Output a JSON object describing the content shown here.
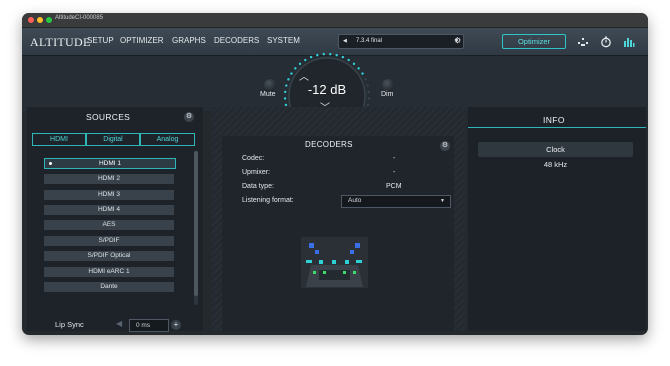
{
  "window": {
    "title": "AltitudeCI-000085"
  },
  "nav": {
    "logo": "ALTITUDE",
    "items": [
      "SETUP",
      "OPTIMIZER",
      "GRAPHS",
      "DECODERS",
      "SYSTEM"
    ],
    "preset": "7.3.4 final",
    "optimizer_label": "Optimizer"
  },
  "volume": {
    "value": "-12 dB",
    "mute_label": "Mute",
    "dim_label": "Dim"
  },
  "sources": {
    "title": "SOURCES",
    "tabs": [
      "HDMI",
      "Digital",
      "Analog"
    ],
    "items": [
      "HDMI 1",
      "HDMI 2",
      "HDMI 3",
      "HDMI 4",
      "AES",
      "S/PDIF",
      "S/PDIF Optical",
      "HDMI eARC 1",
      "Dante"
    ],
    "selected_index": 0,
    "lip_sync_label": "Lip Sync",
    "lip_sync_value": "0 ms"
  },
  "decoders": {
    "title": "DECODERS",
    "codec_label": "Codec:",
    "codec_value": "-",
    "upmixer_label": "Upmixer:",
    "upmixer_value": "-",
    "datatype_label": "Data type:",
    "datatype_value": "PCM",
    "listening_label": "Listening format:",
    "listening_value": "Auto"
  },
  "info": {
    "title": "INFO",
    "clock_label": "Clock",
    "clock_value": "48 kHz"
  },
  "colors": {
    "accent": "#2fb6b9",
    "background": "#24292e",
    "speaker_active": "#2fd0d6",
    "speaker_green": "#3ddc6a"
  },
  "icons": [
    "speaker-layout-icon",
    "timer-icon",
    "level-meter-icon",
    "gear-icon"
  ]
}
